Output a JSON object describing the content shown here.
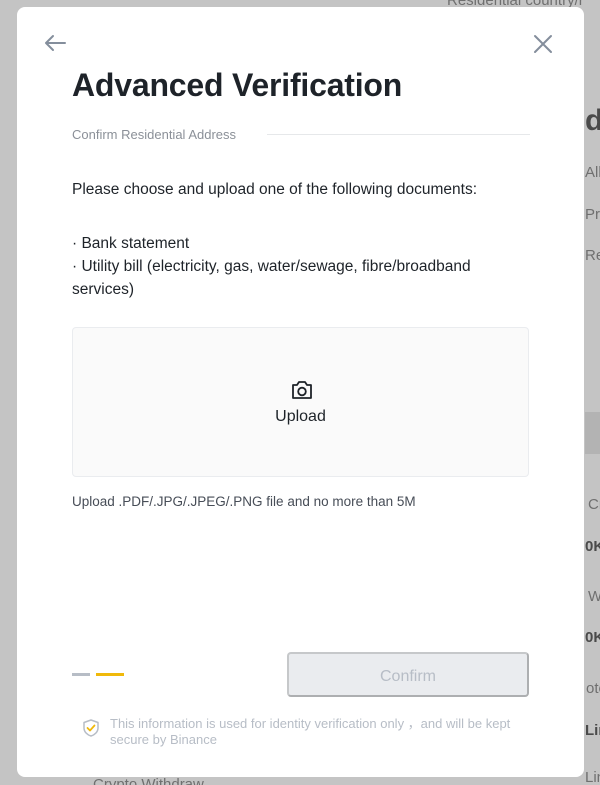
{
  "background": {
    "top_text": "Residential country/r",
    "letters": [
      "dv",
      "All",
      "Pro",
      "Re",
      "Cr",
      "0K",
      "W",
      "0K",
      "oto",
      "Lin",
      "Lin"
    ],
    "footer_text": "Crypto Withdraw"
  },
  "modal": {
    "back_icon": "arrow-left-icon",
    "close_icon": "close-icon",
    "title": "Advanced Verification",
    "step_label": "Confirm Residential Address",
    "instructions": "Please choose and upload one of the following documents:",
    "documents": [
      "Bank statement",
      "Utility bill (electricity, gas, water/sewage, fibre/broadband services)"
    ],
    "upload": {
      "icon": "camera-icon",
      "label": "Upload"
    },
    "file_hint": "Upload .PDF/.JPG/.JPEG/.PNG file and no more than 5M",
    "progress": {
      "total_steps": 2,
      "current_step": 2
    },
    "confirm_label": "Confirm",
    "secure_note": "This information is used for identity verification only ，and will be kept secure by Binance",
    "colors": {
      "accent": "#f0b90b",
      "disabled_bg": "#eaecef",
      "disabled_text": "#b7bdc6"
    }
  }
}
